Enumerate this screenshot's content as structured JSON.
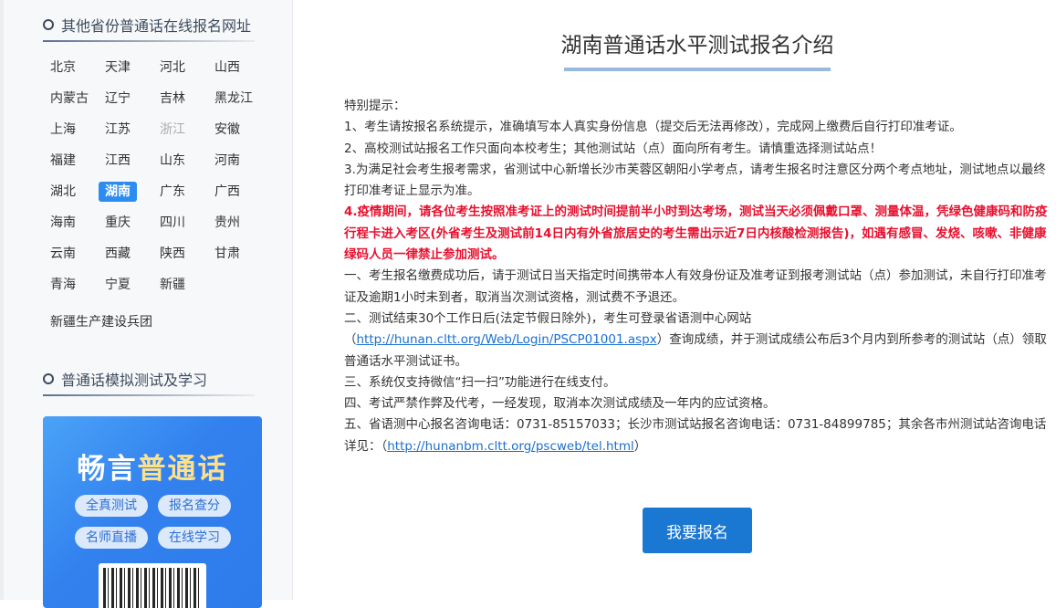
{
  "sidebar": {
    "provinces_title": "其他省份普通话在线报名网址",
    "provinces": [
      "北京",
      "天津",
      "河北",
      "山西",
      "内蒙古",
      "辽宁",
      "吉林",
      "黑龙江",
      "上海",
      "江苏",
      "浙江",
      "安徽",
      "福建",
      "江西",
      "山东",
      "河南",
      "湖北",
      "湖南",
      "广东",
      "广西",
      "海南",
      "重庆",
      "四川",
      "贵州",
      "云南",
      "西藏",
      "陕西",
      "甘肃",
      "青海",
      "宁夏",
      "新疆"
    ],
    "active_province": "湖南",
    "disabled_province": "浙江",
    "extra": "新疆生产建设兵团",
    "practice_title": "普通话模拟测试及学习",
    "promo": {
      "brand_a": "畅言",
      "brand_b": "普通话",
      "pills": [
        "全真测试",
        "报名查分",
        "名师直播",
        "在线学习"
      ]
    }
  },
  "main": {
    "title": "湖南普通话水平测试报名介绍",
    "notice_label": "特别提示：",
    "n1": "1、考生请按报名系统提示，准确填写本人真实身份信息（提交后无法再修改），完成网上缴费后自行打印准考证。",
    "n2": "2、高校测试站报名工作只面向本校考生；其他测试站（点）面向所有考生。请慎重选择测试站点！",
    "n3": "3.为满足社会考生报考需求，省测试中心新增长沙市芙蓉区朝阳小学考点，请考生报名时注意区分两个考点地址，测试地点以最终打印准考证上显示为准。",
    "n4": "4.疫情期间，请各位考生按照准考证上的测试时间提前半小时到达考场，测试当天必须佩戴口罩、测量体温，凭绿色健康码和防疫行程卡进入考区(外省考生及测试前14日内有外省旅居史的考生需出示近7日内核酸检测报告)，如遇有感冒、发烧、咳嗽、非健康绿码人员一律禁止参加测试。",
    "r1": "一、考生报名缴费成功后，请于测试日当天指定时间携带本人有效身份证及准考证到报考测试站（点）参加测试，未自行打印准考证及逾期1小时未到者，取消当次测试资格，测试费不予退还。",
    "r2a": "二、测试结束30个工作日后(法定节假日除外)，考生可登录省语测中心网站",
    "r2_open": "（",
    "r2_link": "http://hunan.cltt.org/Web/Login/PSCP01001.aspx",
    "r2b": "）查询成绩，并于测试成绩公布后3个月内到所参考的测试站（点）领取普通话水平测试证书。",
    "r3": "三、系统仅支持微信“扫一扫”功能进行在线支付。",
    "r4": "四、考试严禁作弊及代考，一经发现，取消本次测试成绩及一年内的应试资格。",
    "r5a": "五、省语测中心报名咨询电话：0731-85157033；长沙市测试站报名咨询电话：0731-84899785；其余各市州测试站咨询电话详见：（",
    "r5_link": "http://hunanbm.cltt.org/pscweb/tel.html",
    "r5b": "）",
    "apply_button": "我要报名"
  }
}
